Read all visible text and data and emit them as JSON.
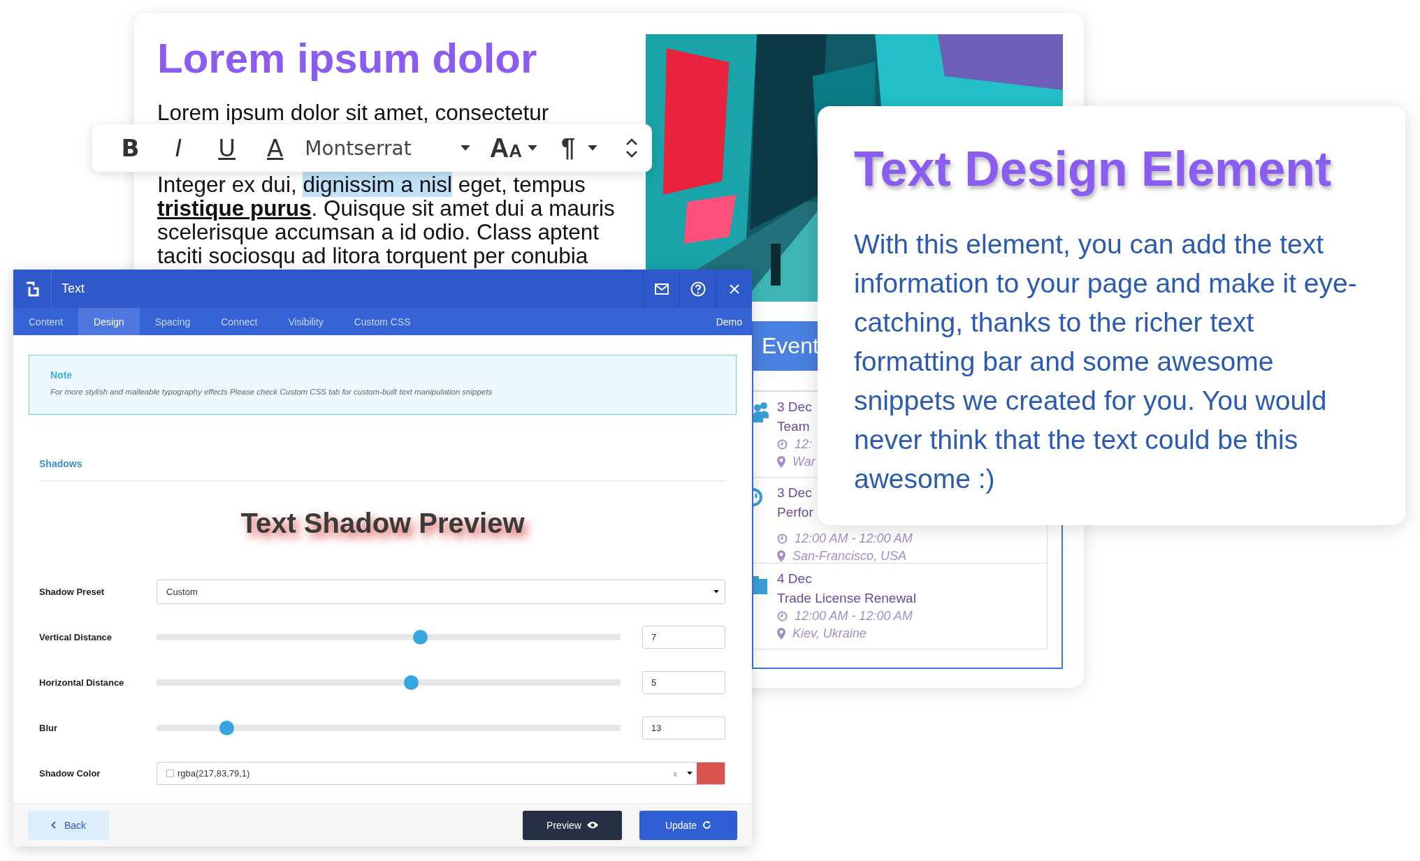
{
  "article": {
    "title": "Lorem ipsum dolor",
    "intro": "Lorem ipsum dolor sit amet, consectetur",
    "lines": [
      [
        {
          "text": "Integer ex dui, ",
          "selected": false
        },
        {
          "text": "dignissim a nisl",
          "selected": true
        },
        {
          "text": " eget, tempus",
          "selected": false
        }
      ],
      [
        {
          "text": "**tristique purus**. Quisque sit amet dui a mauris",
          "selected": false
        }
      ],
      [
        {
          "text": "scelerisque accumsan a id odio. Class aptent",
          "selected": false
        }
      ],
      [
        {
          "text": "taciti sociosqu ad litora torquent per conubia",
          "selected": false
        }
      ]
    ],
    "photo": {
      "kind": "picture"
    }
  },
  "toolbar": {
    "buttons": [
      {
        "kind": "bold",
        "label": "B"
      },
      {
        "kind": "italic",
        "label": "I"
      },
      {
        "kind": "underline",
        "label": "U"
      },
      {
        "kind": "color",
        "label": "A"
      }
    ],
    "font": "Montserrat",
    "size_label": "AA",
    "paragraph_label": "¶"
  },
  "events": {
    "title": "Event",
    "items": [
      {
        "kind": "people",
        "date": "3 Dec",
        "name": "Team",
        "time": "12:",
        "place": "War"
      },
      {
        "kind": "clock",
        "date": "3 Dec",
        "name": "Perfor",
        "time": "12:00 AM - 12:00 AM",
        "place": "San-Francisco, USA"
      },
      {
        "kind": "briefcase",
        "date": "4 Dec",
        "name": "Trade License Renewal",
        "time": "12:00 AM - 12:00 AM",
        "place": "Kiev, Ukraine"
      }
    ]
  },
  "settings": {
    "title": "Text",
    "tabs": [
      {
        "label": "Content",
        "selected": false
      },
      {
        "label": "Design",
        "selected": true
      },
      {
        "label": "Spacing",
        "selected": false
      },
      {
        "label": "Connect",
        "selected": false
      },
      {
        "label": "Visibility",
        "selected": false
      },
      {
        "label": "Custom CSS",
        "selected": false
      }
    ],
    "demo": "Demo",
    "note": {
      "title": "Note",
      "text": "For more stylish and malleable typography effects Please check Custom CSS tab for custom-built text manipulation snippets"
    },
    "section": "Shadows",
    "preview": "Text Shadow Preview",
    "fields": [
      {
        "kind": "select",
        "label": "Shadow Preset",
        "value": "Custom"
      },
      {
        "kind": "slider",
        "label": "Vertical Distance",
        "level": 0.57,
        "value": "7"
      },
      {
        "kind": "slider",
        "label": "Horizontal Distance",
        "level": 0.55,
        "value": "5"
      },
      {
        "kind": "slider",
        "label": "Blur",
        "level": 0.14,
        "value": "13"
      },
      {
        "kind": "color",
        "label": "Shadow Color",
        "value": "rgba(217,83,79,1)",
        "checked": false,
        "clear": "x",
        "color": "#d9534f"
      }
    ],
    "back": "Back",
    "preview_button": "Preview",
    "update": "Update"
  },
  "feature": {
    "title": "Text Design Element",
    "text": "With this element, you can add the text information to your page and make it eye-catching, thanks to the richer text formatting bar and some awesome snippets we created for you. You would never think that the text could be this awesome :)"
  }
}
